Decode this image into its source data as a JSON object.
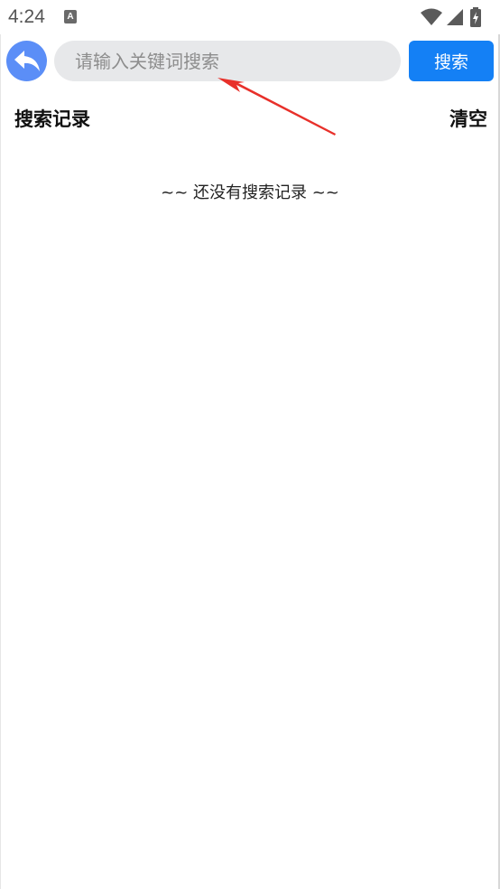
{
  "status_bar": {
    "time": "4:24",
    "app_icon_letter": "A",
    "icons": [
      "wifi-icon",
      "cellular-signal-icon",
      "battery-charging-icon"
    ]
  },
  "toolbar": {
    "back_icon": "back-arrow-icon",
    "search_placeholder": "请输入关键词搜索",
    "search_value": "",
    "search_button_label": "搜索"
  },
  "history": {
    "title": "搜索记录",
    "clear_label": "清空",
    "empty_message": "~~ 还没有搜索记录 ~~"
  },
  "colors": {
    "accent_blue": "#1480f5",
    "back_button": "#5b8ef7",
    "input_background": "#e7e8ea",
    "annotation_arrow": "#e8302a"
  }
}
